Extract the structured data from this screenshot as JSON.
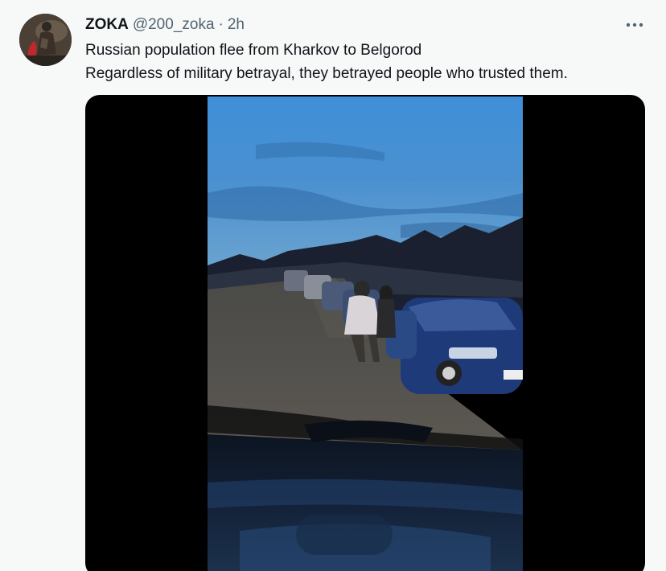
{
  "tweet": {
    "display_name": "ZOKA",
    "handle": "@200_zoka",
    "separator": "·",
    "timestamp": "2h",
    "text_lines": [
      "Russian population flee from Kharkov to Belgorod",
      "Regardless of military betrayal, they betrayed people who trusted them."
    ],
    "more_icon": "more-horizontal-icon"
  },
  "colors": {
    "background": "#f7f9f9",
    "primary_text": "#0f1419",
    "secondary_text": "#536471",
    "media_letterbox": "#000000"
  }
}
